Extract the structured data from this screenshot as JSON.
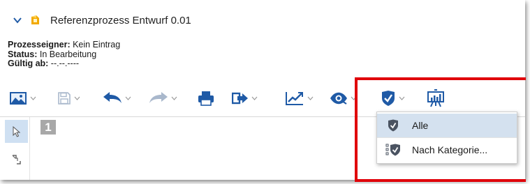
{
  "header": {
    "title": "Referenzprozess Entwurf 0.01"
  },
  "meta": {
    "owner_label": "Prozesseigner:",
    "owner_value": " Kein Eintrag",
    "status_label": "Status:",
    "status_value": " In Bearbeitung",
    "valid_label": "Gültig ab:",
    "valid_value": " --.--.----"
  },
  "canvas": {
    "page_number": "1"
  },
  "filter_menu": {
    "items": [
      {
        "label": "Alle",
        "icon": "shield-check-icon",
        "selected": true
      },
      {
        "label": "Nach Kategorie...",
        "icon": "category-shield-icon",
        "selected": false
      }
    ]
  },
  "colors": {
    "accent": "#1f5aa6",
    "highlight": "#e0000a",
    "selected_bg": "#d4e1ef"
  }
}
